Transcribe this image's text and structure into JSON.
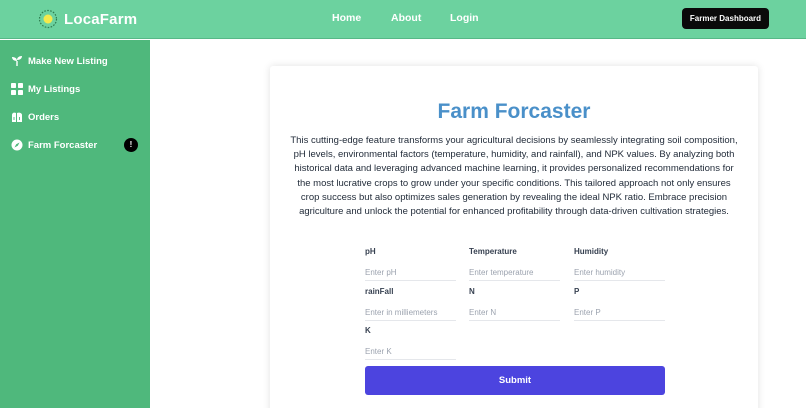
{
  "header": {
    "brand": "LocaFarm",
    "nav": [
      {
        "label": "Home"
      },
      {
        "label": "About"
      },
      {
        "label": "Login"
      }
    ],
    "dashboard_button": "Farmer Dashboard"
  },
  "sidebar": {
    "items": [
      {
        "label": "Make New Listing",
        "icon": "seedling-icon"
      },
      {
        "label": "My Listings",
        "icon": "grid-icon"
      },
      {
        "label": "Orders",
        "icon": "orders-icon"
      },
      {
        "label": "Farm Forcaster",
        "icon": "compass-icon",
        "badge": "!"
      }
    ]
  },
  "main": {
    "title": "Farm Forcaster",
    "description": "This cutting-edge feature transforms your agricultural decisions by seamlessly integrating soil composition, pH levels, environmental factors (temperature, humidity, and rainfall), and NPK values. By analyzing both historical data and leveraging advanced machine learning, it provides personalized recommendations for the most lucrative crops to grow under your specific conditions. This tailored approach not only ensures crop success but also optimizes sales generation by revealing the ideal NPK ratio. Embrace precision agriculture and unlock the potential for enhanced profitability through data-driven cultivation strategies.",
    "fields": [
      {
        "label": "pH",
        "placeholder": "Enter pH",
        "value": ""
      },
      {
        "label": "Temperature",
        "placeholder": "Enter temperature",
        "value": ""
      },
      {
        "label": "Humidity",
        "placeholder": "Enter humidity",
        "value": ""
      },
      {
        "label": "rainFall",
        "placeholder": "Enter in milliemeters",
        "value": ""
      },
      {
        "label": "N",
        "placeholder": "Enter N",
        "value": ""
      },
      {
        "label": "P",
        "placeholder": "Enter P",
        "value": ""
      },
      {
        "label": "K",
        "placeholder": "Enter K",
        "value": ""
      }
    ],
    "submit_label": "Submit"
  },
  "colors": {
    "header": "#6cd29f",
    "sidebar": "#4fb87c",
    "title": "#4a90c9",
    "submit": "#4c44df",
    "dashboard_button": "#0a0a0a"
  }
}
